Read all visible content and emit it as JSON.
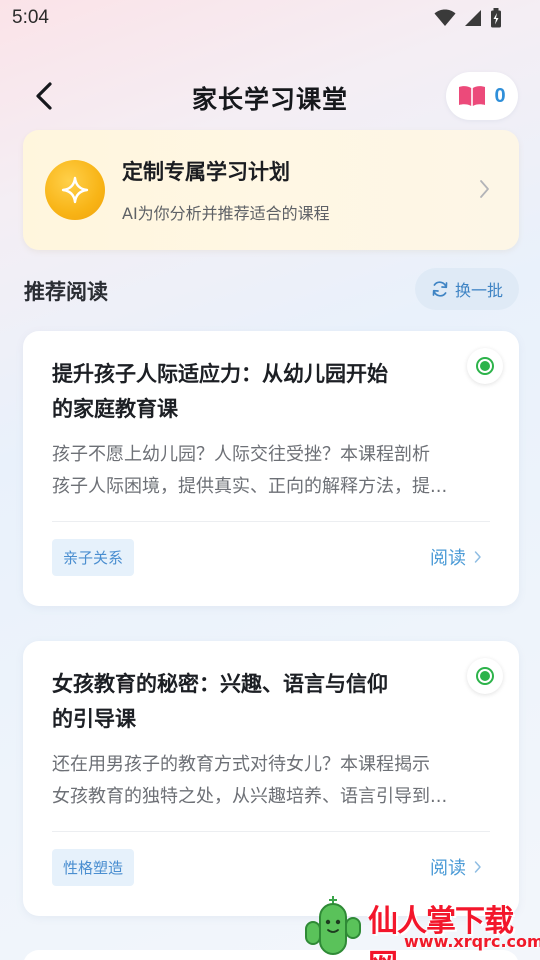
{
  "status_bar": {
    "time": "5:04"
  },
  "header": {
    "title": "家长学习课堂",
    "book_count": "0"
  },
  "plan_card": {
    "title": "定制专属学习计划",
    "subtitle": "AI为你分析并推荐适合的课程"
  },
  "section": {
    "title": "推荐阅读",
    "refresh_label": "换一批"
  },
  "courses": [
    {
      "title_line1": "提升孩子人际适应力：从幼儿园开始",
      "title_line2": "的家庭教育课",
      "desc_line1": "孩子不愿上幼儿园？人际交往受挫？本课程剖析",
      "desc_line2": "孩子人际困境，提供真实、正向的解释方法，提...",
      "tag": "亲子关系",
      "read_label": "阅读"
    },
    {
      "title_line1": "女孩教育的秘密：兴趣、语言与信仰",
      "title_line2": "的引导课",
      "desc_line1": "还在用男孩子的教育方式对待女儿？本课程揭示",
      "desc_line2": "女孩教育的独特之处，从兴趣培养、语言引导到...",
      "tag": "性格塑造",
      "read_label": "阅读"
    }
  ],
  "watermark": {
    "text": "仙人掌下载网",
    "url": "www.xrqrc.com"
  },
  "colors": {
    "accent": "#2f8fd9",
    "radio": "#2cb34a",
    "plan_icon": "#f8b416",
    "watermark": "#f3162b"
  }
}
